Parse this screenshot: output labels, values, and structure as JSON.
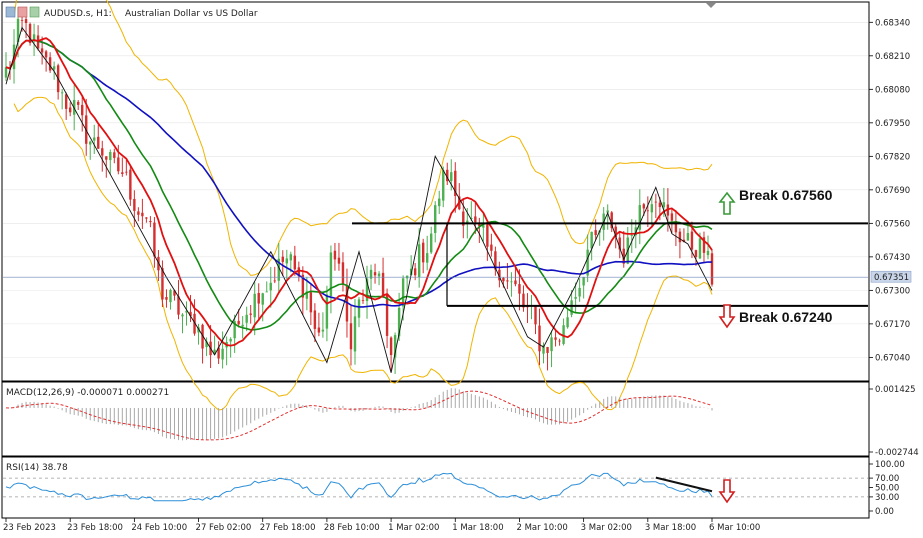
{
  "header": {
    "symbol": "AUDUSD.s, H1:",
    "description": "Australian Dollar vs US Dollar"
  },
  "colors": {
    "bull": "#4caf50",
    "bear": "#d32f2f",
    "ma_blue": "#1010c0",
    "ma_green": "#138a13",
    "ma_red": "#e01010",
    "bollinger": "#f0b400",
    "macd_hist": "#a9a9a9",
    "macd_signal": "#e03030",
    "rsi": "#2d8fd8",
    "grid": "#e4e4e4"
  },
  "icons": [
    "chart-type-icon-1",
    "chart-type-icon-2",
    "chart-type-icon-3"
  ],
  "chart_data": [
    {
      "type": "candlestick",
      "ylim": [
        0.6696,
        0.6838
      ],
      "yticks": [
        0.6834,
        0.6821,
        0.6808,
        0.6795,
        0.6782,
        0.6769,
        0.6756,
        0.6743,
        0.673,
        0.6717,
        0.6704
      ],
      "ytick_labels": [
        "0.68340",
        "0.68210",
        "0.68080",
        "0.67950",
        "0.67820",
        "0.67690",
        "0.67560",
        "0.67430",
        "0.67300",
        "0.67170",
        "0.67040"
      ],
      "current_price": "0.67351",
      "current_value": 0.67351,
      "anchors": [
        [
          0,
          0.6815
        ],
        [
          4,
          0.6833
        ],
        [
          10,
          0.6818
        ],
        [
          16,
          0.6802
        ],
        [
          22,
          0.6787
        ],
        [
          28,
          0.6777
        ],
        [
          34,
          0.676
        ],
        [
          40,
          0.6727
        ],
        [
          46,
          0.6718
        ],
        [
          52,
          0.6705
        ],
        [
          56,
          0.6712
        ],
        [
          60,
          0.6723
        ],
        [
          64,
          0.6731
        ],
        [
          70,
          0.6742
        ],
        [
          74,
          0.6732
        ],
        [
          78,
          0.6712
        ],
        [
          82,
          0.6745
        ],
        [
          86,
          0.6712
        ],
        [
          88,
          0.6725
        ],
        [
          92,
          0.6738
        ],
        [
          96,
          0.6708
        ],
        [
          100,
          0.6735
        ],
        [
          104,
          0.6745
        ],
        [
          110,
          0.6775
        ],
        [
          114,
          0.676
        ],
        [
          118,
          0.6752
        ],
        [
          122,
          0.674
        ],
        [
          126,
          0.6732
        ],
        [
          130,
          0.6722
        ],
        [
          134,
          0.6708
        ],
        [
          138,
          0.6712
        ],
        [
          142,
          0.673
        ],
        [
          146,
          0.6748
        ],
        [
          150,
          0.6758
        ],
        [
          154,
          0.6744
        ],
        [
          158,
          0.6762
        ],
        [
          162,
          0.6768
        ],
        [
          166,
          0.6755
        ],
        [
          170,
          0.6748
        ],
        [
          174,
          0.6746
        ],
        [
          176,
          0.6735
        ]
      ],
      "line_x": [
        [
          0,
          0.681
        ],
        [
          4,
          0.6832
        ],
        [
          12,
          0.6815
        ],
        [
          40,
          0.6735
        ],
        [
          52,
          0.6705
        ],
        [
          66,
          0.6745
        ],
        [
          80,
          0.6702
        ],
        [
          88,
          0.6745
        ],
        [
          96,
          0.6698
        ],
        [
          107,
          0.6782
        ],
        [
          118,
          0.6752
        ],
        [
          130,
          0.6712
        ],
        [
          134,
          0.6708
        ],
        [
          142,
          0.6732
        ],
        [
          150,
          0.676
        ],
        [
          154,
          0.6742
        ],
        [
          162,
          0.677
        ],
        [
          166,
          0.6752
        ],
        [
          170,
          0.6748
        ],
        [
          176,
          0.673
        ]
      ],
      "resistance": {
        "value": 0.6756,
        "label": "Break 0.67560"
      },
      "support": {
        "value": 0.6724,
        "label": "Break 0.67240"
      },
      "xtick_labels": [
        "23 Feb 2023",
        "23 Feb 18:00",
        "24 Feb 10:00",
        "27 Feb 02:00",
        "27 Feb 18:00",
        "28 Feb 10:00",
        "1 Mar 02:00",
        "1 Mar 18:00",
        "2 Mar 10:00",
        "3 Mar 02:00",
        "3 Mar 18:00",
        "6 Mar 10:00"
      ]
    },
    {
      "type": "macd",
      "label": "MACD(12,26,9) -0.000071 0.000271",
      "ylim": [
        -0.00274,
        0.001425
      ],
      "ytick_labels": [
        "0.001425",
        "-0.002744"
      ]
    },
    {
      "type": "rsi",
      "label": "RSI(14) 38.78",
      "ylim": [
        0,
        100
      ],
      "yticks": [
        100,
        70,
        50,
        30,
        0
      ],
      "ytick_labels": [
        "100.00",
        "70.00",
        "50.00",
        "30.00",
        "0.00"
      ],
      "levels": [
        70,
        30
      ],
      "divergence_line": [
        [
          162,
          71
        ],
        [
          176,
          42
        ]
      ]
    }
  ]
}
